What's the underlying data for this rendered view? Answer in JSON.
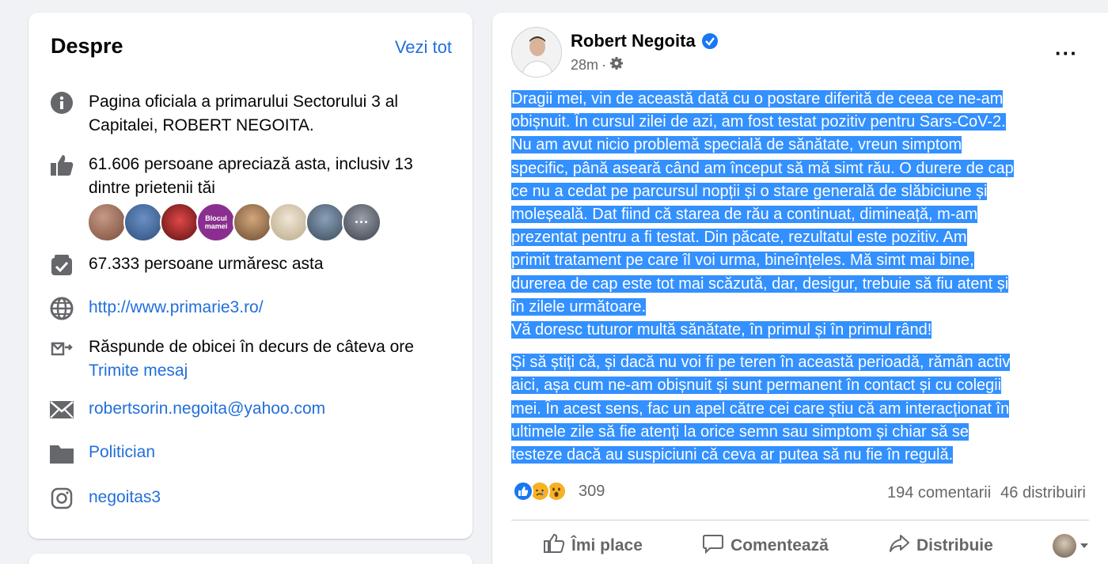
{
  "about": {
    "title": "Despre",
    "see_all": "Vezi tot",
    "description": "Pagina oficiala a primarului Sectorului 3 al Capitalei, ROBERT NEGOITA.",
    "likes": "61.606 persoane apreciază asta, inclusiv 13 dintre prietenii tăi",
    "followers": "67.333 persoane urmăresc asta",
    "website": "http://www.primarie3.ro/",
    "response_time": "Răspunde de obicei în decurs de câteva ore",
    "send_message": "Trimite mesaj",
    "email": "robertsorin.negoita@yahoo.com",
    "category": "Politician",
    "instagram": "negoitas3",
    "friend_avatar_colors": [
      "#7a4a3a",
      "#2c4f7c",
      "#b12a2a",
      "#8a2f8f",
      "#9c7150",
      "#d8c9b0",
      "#4a5a6a",
      "#5a5f6a"
    ],
    "friend_avatar_text": "Blocul mamei"
  },
  "post": {
    "author": "Robert Negoita",
    "time": "28m",
    "paragraph_1_lines": [
      "Dragii mei, vin de această dată cu o postare diferită de ceea ce ne-am",
      "obișnuit. În cursul zilei de azi, am fost testat pozitiv pentru Sars-CoV-2.",
      "Nu am avut nicio problemă specială de sănătate, vreun simptom",
      "specific, până aseară când am început să mă simt rău. O durere de cap",
      "ce nu a cedat pe parcursul nopții și o stare generală de slăbiciune și",
      "moleșeală. Dat fiind că starea de rău a continuat, dimineață,  m-am",
      "prezentat pentru a fi testat. Din păcate, rezultatul este pozitiv. Am",
      "primit tratament pe care îl voi urma, bineînțeles. Mă simt mai bine,",
      "durerea de cap este tot mai scăzută, dar, desigur, trebuie să fiu atent și",
      "în zilele următoare.",
      "Vă doresc tuturor multă sănătate, în primul și în primul rând!"
    ],
    "paragraph_2_lines": [
      "Și să știți că, și dacă nu voi fi pe teren în această perioadă, rămân activ",
      "aici, așa cum ne-am obișnuit și sunt permanent în contact și cu colegii",
      "mei. În acest sens, fac un apel către cei care știu că am interacționat în",
      "ultimele zile să fie atenți la orice semn sau simptom și chiar să se",
      "testeze dacă au suspiciuni că ceva ar putea să nu fie în regulă."
    ],
    "reaction_count": "309",
    "comments": "194 comentarii",
    "shares": "46 distribuiri",
    "like_label": "Îmi place",
    "comment_label": "Comentează",
    "share_label": "Distribuie",
    "selection_color": "#3390ff",
    "link_color": "#216fdb"
  }
}
